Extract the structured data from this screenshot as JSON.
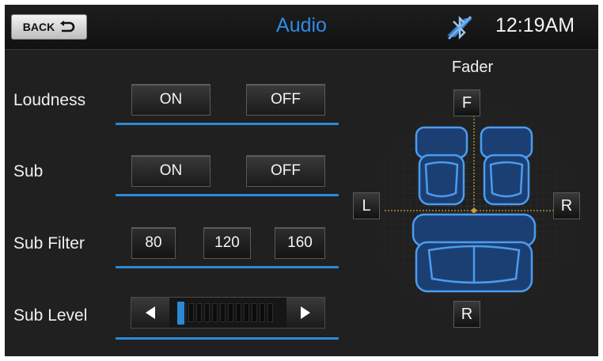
{
  "header": {
    "back_label": "BACK",
    "title": "Audio",
    "time": "12:19AM",
    "bluetooth_icon": "bluetooth-off-icon"
  },
  "settings": {
    "loudness": {
      "label": "Loudness",
      "on": "ON",
      "off": "OFF"
    },
    "sub": {
      "label": "Sub",
      "on": "ON",
      "off": "OFF"
    },
    "sub_filter": {
      "label": "Sub Filter",
      "options": [
        "80",
        "120",
        "160"
      ]
    },
    "sub_level": {
      "label": "Sub Level",
      "level_fraction": 0.0
    }
  },
  "fader": {
    "label": "Fader",
    "front": "F",
    "left": "L",
    "right": "R",
    "rear": "R"
  },
  "colors": {
    "accent": "#2a8ad8",
    "title": "#2f8be6",
    "seat_glow": "#3d8fe8"
  }
}
